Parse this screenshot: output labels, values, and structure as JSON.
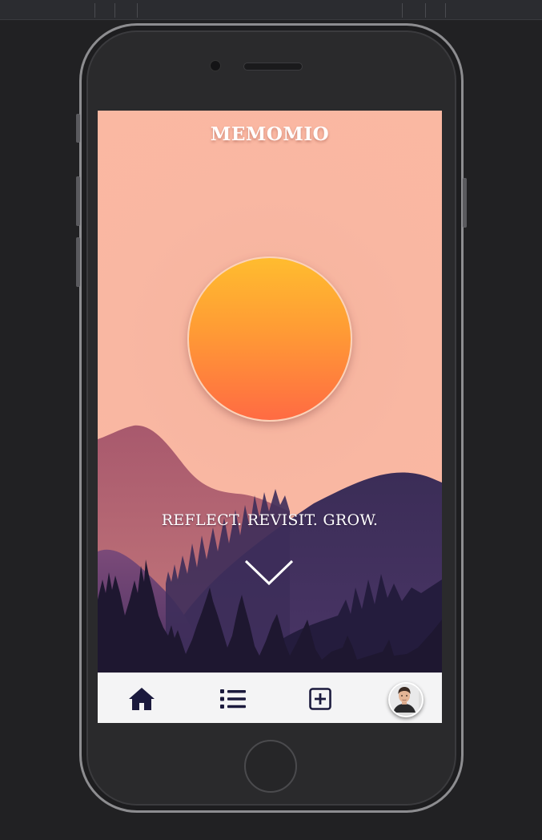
{
  "app": {
    "title": "MEMOMIO",
    "tagline": "REFLECT. REVISIT. GROW."
  },
  "icons": {
    "scroll": "chevron-down-icon",
    "nav": [
      "home-icon",
      "list-icon",
      "add-entry-icon",
      "profile-avatar"
    ]
  },
  "colors": {
    "sky": "#fbb8a2",
    "sun_top": "#ffbc2f",
    "sun_bottom": "#ff6b43",
    "mountain_back": "#a8596d",
    "mountain_mid": "#3e2f5c",
    "forest": "#1e1730",
    "nav_background": "#f4f4f5",
    "nav_icon": "#1b1a3d"
  }
}
